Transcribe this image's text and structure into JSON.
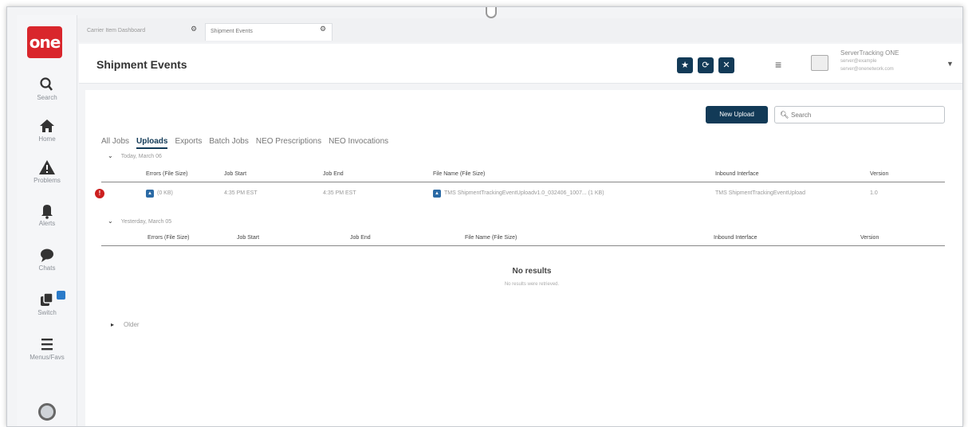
{
  "window_tabs": [
    {
      "label": "Carrier Item Dashboard"
    },
    {
      "label": "Shipment Events"
    }
  ],
  "sidebar": {
    "logo": "one",
    "items": [
      {
        "label": "Search",
        "icon": "search-icon"
      },
      {
        "label": "Home",
        "icon": "home-icon"
      },
      {
        "label": "Problems",
        "icon": "warning-icon"
      },
      {
        "label": "Alerts",
        "icon": "bell-icon"
      },
      {
        "label": "Chats",
        "icon": "chat-icon"
      },
      {
        "label": "Switch",
        "icon": "switch-icon"
      },
      {
        "label": "Menus/Favs",
        "icon": "menu-icon"
      }
    ]
  },
  "header": {
    "title": "Shipment Events",
    "actions": [
      {
        "icon": "star-icon",
        "glyph": "★"
      },
      {
        "icon": "refresh-icon",
        "glyph": "⟳"
      },
      {
        "icon": "close-icon",
        "glyph": "✕"
      }
    ],
    "user": {
      "name": "ServerTracking ONE",
      "line2": "server@example",
      "line3": "server@onenetwork.com"
    }
  },
  "toolbar": {
    "new_upload": "New Upload",
    "search_placeholder": "Search"
  },
  "tabs": [
    {
      "label": "All Jobs",
      "active": false
    },
    {
      "label": "Uploads",
      "active": true
    },
    {
      "label": "Exports",
      "active": false
    },
    {
      "label": "Batch Jobs",
      "active": false
    },
    {
      "label": "NEO Prescriptions",
      "active": false
    },
    {
      "label": "NEO Invocations",
      "active": false
    }
  ],
  "columns": {
    "errors": "Errors (File Size)",
    "job_start": "Job Start",
    "job_end": "Job End",
    "file_name": "File Name (File Size)",
    "inbound": "Inbound Interface",
    "version": "Version"
  },
  "groups": {
    "today": {
      "label": "Today, March 06",
      "rows": [
        {
          "error_count_label": "(0 KB)",
          "job_start": "4:35 PM EST",
          "job_end": "4:35 PM EST",
          "file_name": "TMS ShipmentTrackingEventUploadv1.0_032406_1007... (1 KB)",
          "inbound": "TMS ShipmentTrackingEventUpload",
          "version": "1.0"
        }
      ]
    },
    "yesterday": {
      "label": "Yesterday, March 05",
      "no_results": "No results",
      "no_results_sub": "No results were retrieved."
    },
    "older": {
      "label": "Older"
    }
  },
  "colors": {
    "brand_red": "#d9262c",
    "accent_navy": "#123a57",
    "error_red": "#cc1f1f",
    "file_blue": "#2b6aa5"
  }
}
